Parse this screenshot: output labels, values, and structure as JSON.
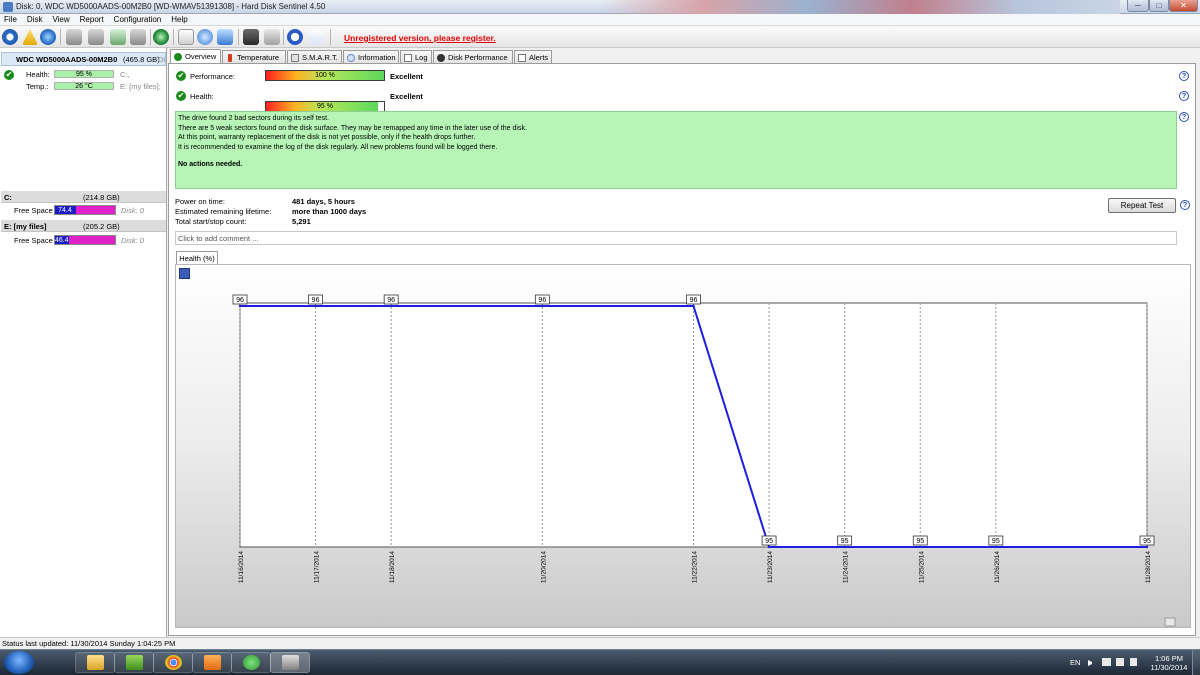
{
  "window": {
    "title": "Disk: 0, WDC WD5000AADS-00M2B0 [WD-WMAV51391308]  -  Hard Disk Sentinel 4.50",
    "minimize_glyph": "─",
    "maximize_glyph": "□",
    "close_glyph": "✕"
  },
  "menu": [
    "File",
    "Disk",
    "View",
    "Report",
    "Configuration",
    "Help"
  ],
  "toolbar": {
    "unregistered_text": "Unregistered version, please register."
  },
  "disk": {
    "name": "WDC WD5000AADS-00M2B0",
    "size": "(465.8 GB)",
    "trunc": "Di",
    "health_label": "Health:",
    "health_value": "95 %",
    "health_drive": "C:,",
    "temp_label": "Temp.:",
    "temp_value": "26 °C",
    "temp_drive": "E: [my files];"
  },
  "volumes": [
    {
      "name": "C:",
      "size": "(214.8 GB)",
      "free_label": "Free Space",
      "free_value": "74.4 GB",
      "free_fraction": 0.346,
      "disk": "Disk: 0"
    },
    {
      "name": "E: [my files]",
      "size": "(205.2 GB)",
      "free_label": "Free Space",
      "free_value": "46.4 GB",
      "free_fraction": 0.226,
      "disk": "Disk: 0"
    }
  ],
  "tabs": [
    "Overview",
    "Temperature",
    "S.M.A.R.T.",
    "Information",
    "Log",
    "Disk Performance",
    "Alerts"
  ],
  "overview": {
    "performance_label": "Performance:",
    "performance_value": "100 %",
    "performance_fraction": 1.0,
    "performance_rating": "Excellent",
    "health_label": "Health:",
    "health_value": "95 %",
    "health_fraction": 0.95,
    "health_rating": "Excellent",
    "message_lines": [
      "The drive found 2 bad sectors during its self test.",
      "There are 5 weak sectors found on the disk surface. They may be remapped any time in the later use of the disk.",
      "At this point, warranty replacement of the disk is not yet possible, only if the health drops further.",
      "It is recommended to examine the log of the disk regularly. All new problems found will be logged there."
    ],
    "message_action": "No actions needed.",
    "power_on_label": "Power on time:",
    "power_on_value": "481 days, 5 hours",
    "lifetime_label": "Estimated remaining lifetime:",
    "lifetime_value": "more than 1000 days",
    "startstop_label": "Total start/stop count:",
    "startstop_value": "5,291",
    "repeat_test": "Repeat Test",
    "comment_placeholder": "Click to add comment ...",
    "health_tab": "Health (%)",
    "help_glyph": "?",
    "check_glyph": "✔"
  },
  "chart_data": {
    "type": "line",
    "title": "",
    "xlabel": "",
    "ylabel": "",
    "x": [
      "11/16/2014",
      "11/17/2014",
      "11/18/2014",
      "11/20/2014",
      "11/22/2014",
      "11/23/2014",
      "11/24/2014",
      "11/25/2014",
      "11/26/2014",
      "11/28/2014"
    ],
    "values": [
      96,
      96,
      96,
      96,
      96,
      95,
      95,
      95,
      95,
      95
    ],
    "ylim": [
      95,
      96
    ],
    "grid": true,
    "line_color": "#1e1ee0"
  },
  "status": {
    "text": "Status last updated: 11/30/2014 Sunday 1:04:25 PM"
  },
  "taskbar": {
    "language": "EN",
    "time": "1:06 PM",
    "date": "11/30/2014"
  }
}
